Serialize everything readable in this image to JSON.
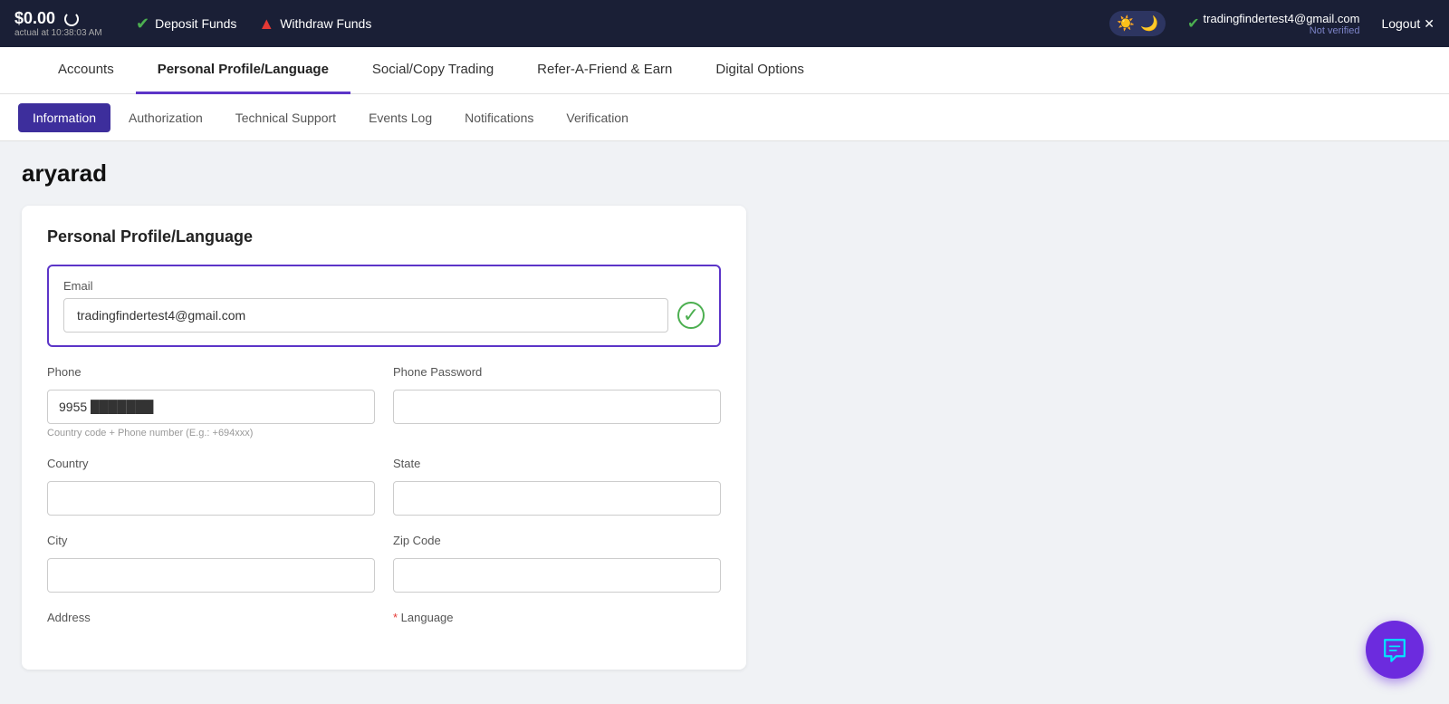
{
  "topbar": {
    "balance": "$0.00",
    "balance_label": "actual at 10:38:03 AM",
    "deposit_label": "Deposit Funds",
    "withdraw_label": "Withdraw Funds",
    "theme_sun": "☀️",
    "theme_moon": "🌙",
    "user_email": "tradingfindertest4@gmail.com",
    "user_status": "Not verified",
    "logout_label": "Logout",
    "close_icon": "✕"
  },
  "navbar": {
    "items": [
      {
        "label": "Accounts",
        "active": false
      },
      {
        "label": "Personal Profile/Language",
        "active": true
      },
      {
        "label": "Social/Copy Trading",
        "active": false
      },
      {
        "label": "Refer-A-Friend & Earn",
        "active": false
      },
      {
        "label": "Digital Options",
        "active": false
      }
    ]
  },
  "subtabs": {
    "items": [
      {
        "label": "Information",
        "active": true
      },
      {
        "label": "Authorization",
        "active": false
      },
      {
        "label": "Technical Support",
        "active": false
      },
      {
        "label": "Events Log",
        "active": false
      },
      {
        "label": "Notifications",
        "active": false
      },
      {
        "label": "Verification",
        "active": false
      }
    ]
  },
  "page": {
    "username": "aryarad",
    "form_title": "Personal Profile/Language",
    "email_label": "Email",
    "email_value": "tradingfindertest4@gmail.com",
    "phone_label": "Phone",
    "phone_value": "9955",
    "phone_hint": "Country code + Phone number (E.g.: +694xxx)",
    "phone_password_label": "Phone Password",
    "phone_password_value": "",
    "country_label": "Country",
    "country_value": "",
    "state_label": "State",
    "state_value": "",
    "city_label": "City",
    "city_value": "",
    "zip_label": "Zip Code",
    "zip_value": "",
    "address_label": "Address",
    "language_label": "Language",
    "language_required": true
  }
}
